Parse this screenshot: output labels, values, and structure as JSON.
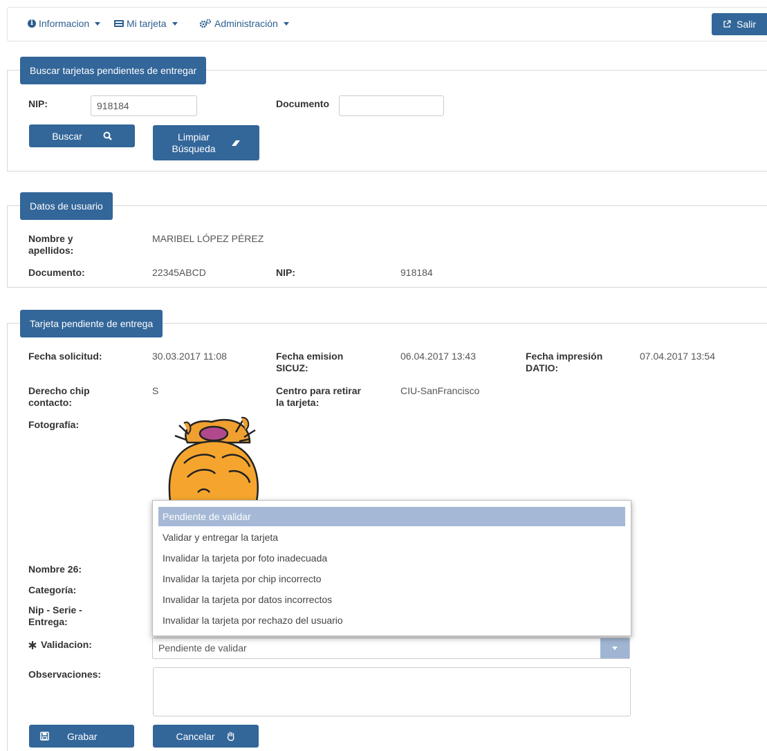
{
  "nav": {
    "info_label": "Informacion",
    "card_label": "Mi tarjeta",
    "admin_label": "Administración",
    "logout_label": "Salir"
  },
  "search": {
    "legend": "Buscar tarjetas pendientes de entregar",
    "nip_label": "NIP:",
    "nip_value": "918184",
    "documento_label": "Documento",
    "documento_value": "",
    "buscar_label": "Buscar",
    "limpiar_label_1": "Limpiar",
    "limpiar_label_2": "Búsqueda"
  },
  "user": {
    "legend": "Datos de usuario",
    "nombre_label_1": "Nombre y",
    "nombre_label_2": "apellidos:",
    "nombre_value": "MARIBEL LÓPEZ PÉREZ",
    "documento_label": "Documento:",
    "documento_value": "22345ABCD",
    "nip_label": "NIP:",
    "nip_value": "918184"
  },
  "card": {
    "legend": "Tarjeta pendiente de entrega",
    "fecha_solicitud_label": "Fecha solicitud:",
    "fecha_solicitud_value": "30.03.2017 11:08",
    "fecha_emision_label_1": "Fecha emision",
    "fecha_emision_label_2": "SICUZ:",
    "fecha_emision_value": "06.04.2017 13:43",
    "fecha_impresion_label_1": "Fecha impresión",
    "fecha_impresion_label_2": "DATIO:",
    "fecha_impresion_value": "07.04.2017 13:54",
    "derecho_label_1": "Derecho chip",
    "derecho_label_2": "contacto:",
    "derecho_value": "S",
    "centro_label_1": "Centro para retirar",
    "centro_label_2": "la tarjeta:",
    "centro_value": "CIU-SanFrancisco",
    "fotografia_label": "Fotografía:",
    "nombre26_label": "Nombre 26:",
    "categoria_label": "Categoría:",
    "nip_serie_label_1": "Nip - Serie -",
    "nip_serie_label_2": "Entrega:",
    "validacion_label": "Validacion:",
    "validacion_value": "Pendiente de validar",
    "observaciones_label": "Observaciones:",
    "observaciones_value": "",
    "grabar_label": "Grabar",
    "cancelar_label": "Cancelar"
  },
  "dropdown": {
    "options": [
      "Pendiente de validar",
      "Validar y entregar la tarjeta",
      "Invalidar la tarjeta por foto inadecuada",
      "Invalidar la tarjeta por chip incorrecto",
      "Invalidar la tarjeta por datos incorrectos",
      "Invalidar la tarjeta por rechazo del usuario"
    ],
    "selected_index": 0
  },
  "colors": {
    "primary": "#336699",
    "link": "#2c5f8f",
    "selected_option": "#a5b9d6"
  }
}
